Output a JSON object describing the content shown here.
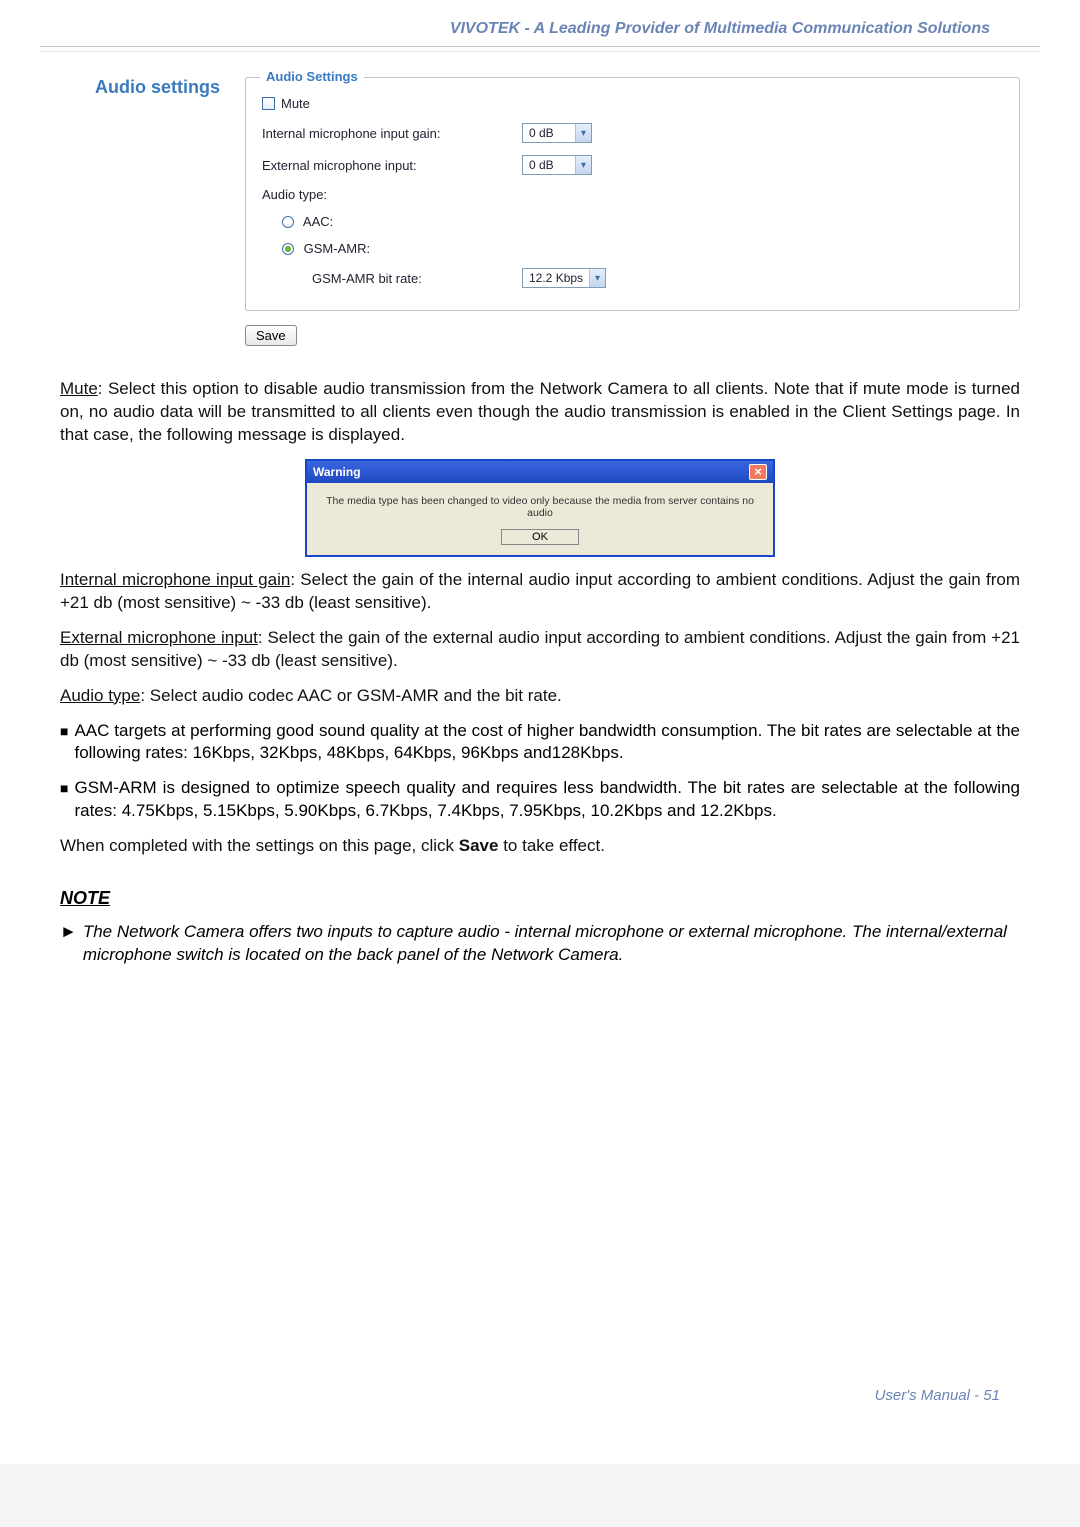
{
  "header": {
    "title": "VIVOTEK - A Leading Provider of Multimedia Communication Solutions"
  },
  "sidebar": {
    "title": "Audio settings"
  },
  "fieldset": {
    "legend": "Audio Settings",
    "mute_label": "Mute",
    "internal_mic_label": "Internal microphone input gain:",
    "internal_mic_value": "0 dB",
    "external_mic_label": "External microphone input:",
    "external_mic_value": "0 dB",
    "audio_type_label": "Audio type:",
    "aac_label": "AAC:",
    "gsm_label": "GSM-AMR:",
    "gsm_bitrate_label": "GSM-AMR bit rate:",
    "gsm_bitrate_value": "12.2 Kbps",
    "save_label": "Save"
  },
  "body": {
    "mute_head": "Mute",
    "mute_text": ": Select this option to disable audio transmission from the Network Camera to all clients. Note that if mute mode is turned on, no audio data will be transmitted to all clients even though the audio transmission is enabled in the Client Settings page. In that case, the following message is displayed.",
    "int_head": "Internal microphone input gain",
    "int_text": ": Select the gain of the internal audio input according to ambient conditions. Adjust the gain from +21 db (most sensitive) ~ -33 db (least sensitive).",
    "ext_head": "External microphone input",
    "ext_text": ": Select the gain of the external audio input according to ambient conditions. Adjust the gain from +21 db (most sensitive) ~ -33 db (least sensitive).",
    "at_head": "Audio type",
    "at_text": ": Select audio codec AAC or GSM-AMR and the bit rate.",
    "bullet_aac": "AAC targets at performing good sound quality at the cost of higher bandwidth consumption. The bit rates are selectable at the following rates: 16Kbps, 32Kbps, 48Kbps, 64Kbps, 96Kbps and128Kbps.",
    "bullet_gsm": "GSM-ARM is designed to optimize speech quality and requires less bandwidth. The bit rates are selectable at the following rates: 4.75Kbps, 5.15Kbps, 5.90Kbps, 6.7Kbps, 7.4Kbps, 7.95Kbps, 10.2Kbps and 12.2Kbps.",
    "complete_pre": "When completed with the settings on this page, click ",
    "complete_save": "Save",
    "complete_post": " to take effect.",
    "note_head": "NOTE",
    "note_text": "The Network Camera offers two inputs to capture audio - internal microphone or external microphone. The internal/external microphone switch is located on the back panel of the Network Camera."
  },
  "warning": {
    "title": "Warning",
    "message": "The media type has been changed to video only because the media from server contains no audio",
    "ok": "OK"
  },
  "footer": {
    "text": "User's Manual - 51"
  }
}
